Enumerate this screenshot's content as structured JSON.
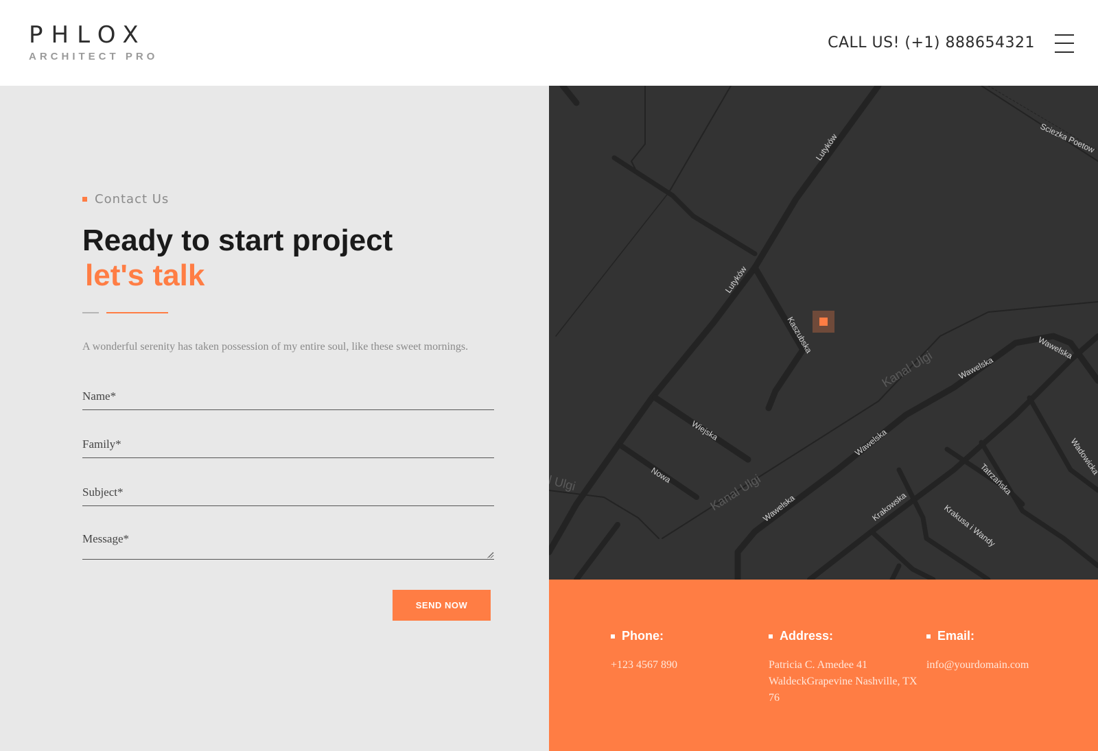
{
  "header": {
    "logo_main": "PHLOX",
    "logo_sub": "ARCHITECT PRO",
    "call_text": "CALL US! (+1) 888654321"
  },
  "contact": {
    "tagline": "Contact Us",
    "heading_line1": "Ready to start project",
    "heading_line2": "let's talk",
    "intro": "A wonderful serenity has taken possession of my entire soul, like these sweet mornings.",
    "fields": {
      "name_placeholder": "Name*",
      "family_placeholder": "Family*",
      "subject_placeholder": "Subject*",
      "message_placeholder": "Message*"
    },
    "send_label": "SEND NOW"
  },
  "map": {
    "labels": [
      "Lutyków",
      "Lutyków",
      "Kaszubska",
      "Sciezka Poetow",
      "Kanal Ulgi",
      "Kanal Ulgi",
      "l Ulgi",
      "Wawelska",
      "Wawelska",
      "Wawelska",
      "Wawelska",
      "Wiejska",
      "Nowa",
      "Krakowska",
      "Tatrzańska",
      "Krakusa i Wandy",
      "Wadowicka"
    ]
  },
  "info": {
    "phone_label": "Phone:",
    "phone_value": "+123 4567 890",
    "address_label": "Address:",
    "address_value": "Patricia C. Amedee 41 WaldeckGrapevine Nashville, TX 76",
    "email_label": "Email:",
    "email_value": "info@yourdomain.com"
  },
  "colors": {
    "accent": "#ff7d44",
    "map_bg": "#333333",
    "panel_bg": "#e8e8e8"
  },
  "icons": {
    "menu": "hamburger-menu-icon",
    "marker": "map-marker-icon"
  }
}
